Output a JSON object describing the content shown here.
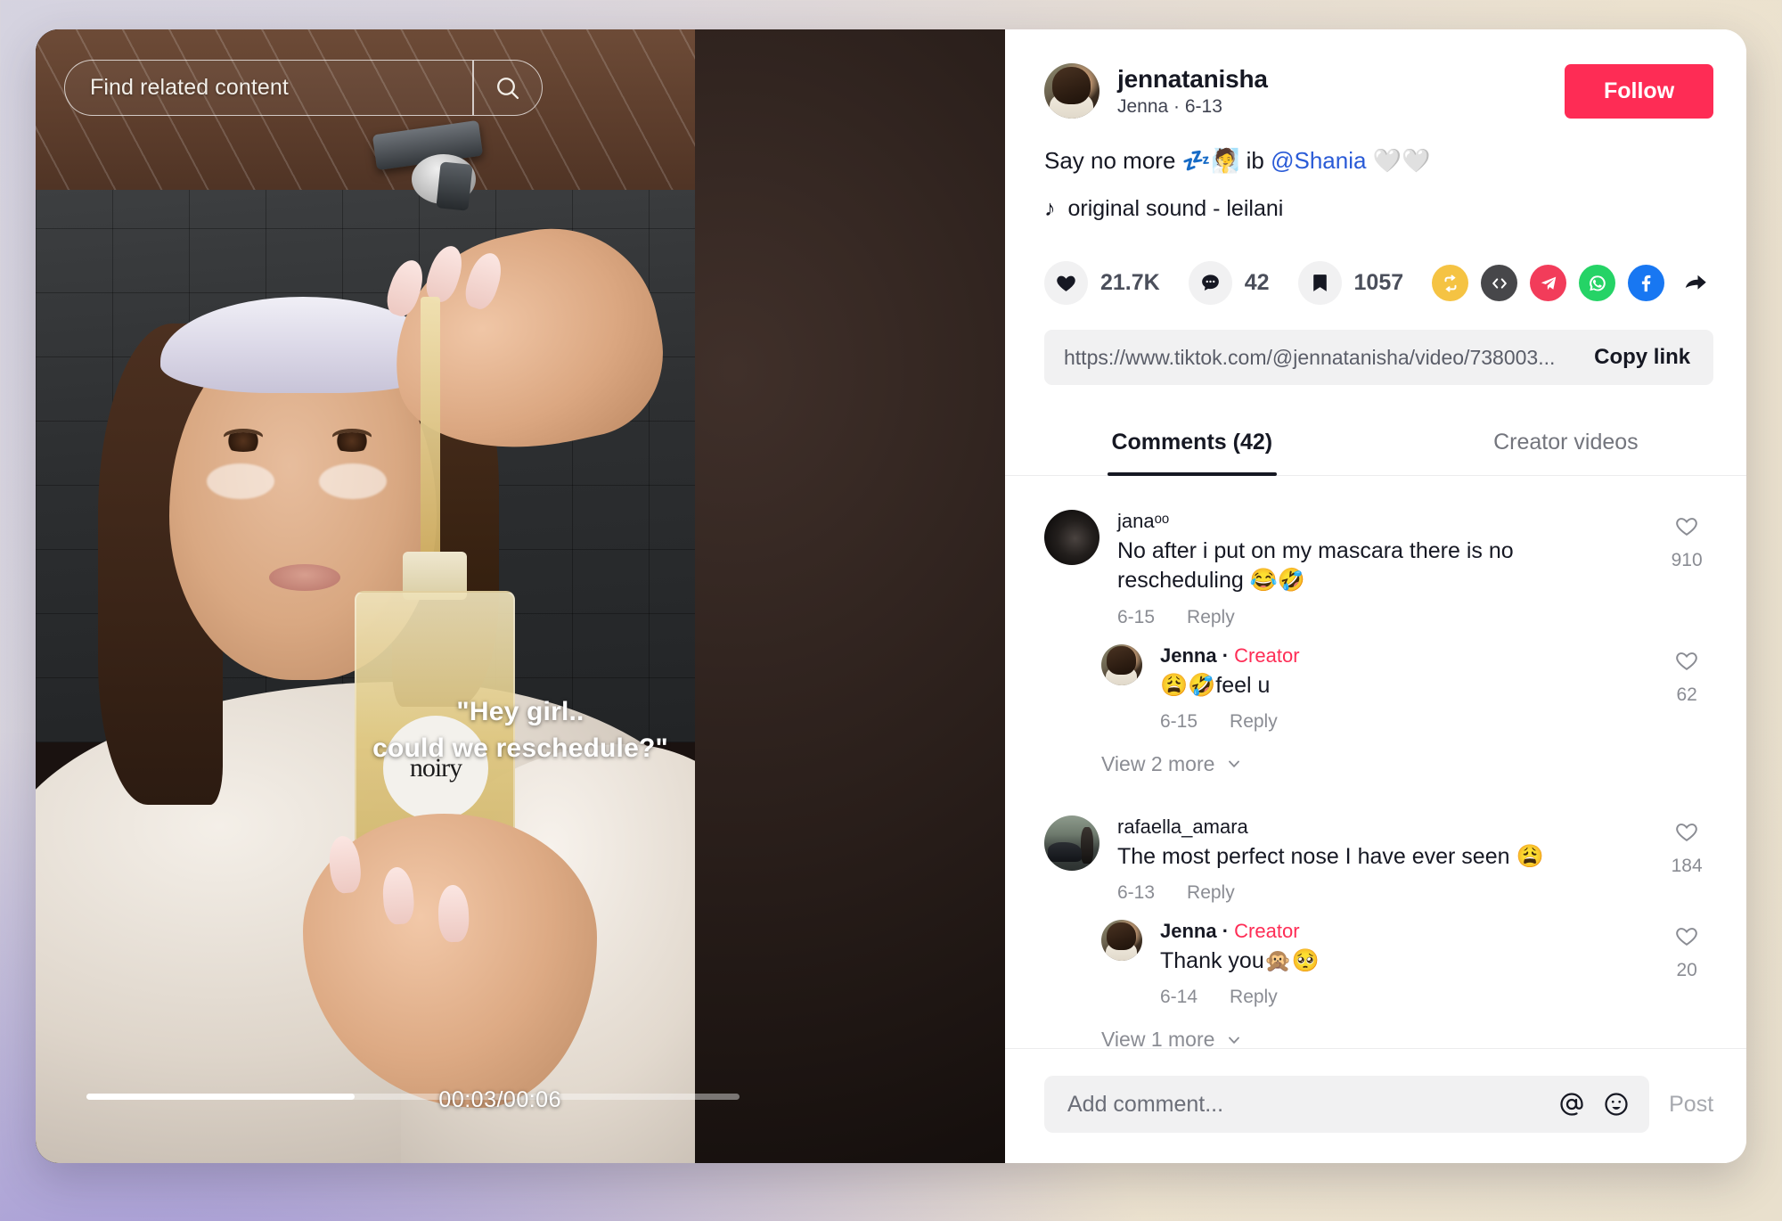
{
  "video": {
    "search_placeholder": "Find related content",
    "search_icon": "search-icon",
    "caption_line1": "\"Hey girl..",
    "caption_line2": "could we reschedule?\"",
    "bottle_label": "noiry",
    "time": "00:03/00:06",
    "progress_percent": 41
  },
  "author": {
    "username": "jennatanisha",
    "display_line": "Jenna · 6-13",
    "follow_label": "Follow"
  },
  "post": {
    "description_pre": "Say no more ",
    "description_emoji1": "💤🧖",
    "description_mid": " ib ",
    "mention": "@Shania",
    "description_emoji2": " 🤍🤍",
    "music_icon": "music-note-icon",
    "music": "original sound - leilani"
  },
  "stats": {
    "likes_icon": "heart-icon",
    "likes": "21.7K",
    "comments_icon": "comment-bubble-icon",
    "comments": "42",
    "saves_icon": "bookmark-icon",
    "saves": "1057"
  },
  "share": [
    {
      "name": "repost-icon",
      "color": "#f5c343"
    },
    {
      "name": "embed-code-icon",
      "color": "#47474a"
    },
    {
      "name": "telegram-icon",
      "color": "#f23c5a"
    },
    {
      "name": "whatsapp-icon",
      "color": "#25d366"
    },
    {
      "name": "facebook-icon",
      "color": "#1877f2"
    },
    {
      "name": "share-arrow-icon",
      "color": "#161823"
    }
  ],
  "link": {
    "url": "https://www.tiktok.com/@jennatanisha/video/738003...",
    "copy_label": "Copy link"
  },
  "tabs": {
    "comments_label": "Comments (42)",
    "creator_label": "Creator videos"
  },
  "comments": [
    {
      "avatar": "dark",
      "name": "janaᵒᵒ",
      "bold": false,
      "is_creator": false,
      "text": "No after i put on my mascara there is no rescheduling 😂🤣",
      "date": "6-15",
      "reply_label": "Reply",
      "like_icon": "heart-outline-icon",
      "likes": "910",
      "replies": [
        {
          "avatar": "creator",
          "name": "Jenna",
          "creator_tag": "Creator",
          "text": "😩🤣feel u",
          "date": "6-15",
          "reply_label": "Reply",
          "like_icon": "heart-outline-icon",
          "likes": "62"
        }
      ],
      "view_more": "View 2 more"
    },
    {
      "avatar": "car",
      "name": "rafaella_amara",
      "bold": false,
      "is_creator": false,
      "text": "The most perfect nose I have ever seen 😩",
      "date": "6-13",
      "reply_label": "Reply",
      "like_icon": "heart-outline-icon",
      "likes": "184",
      "replies": [
        {
          "avatar": "creator",
          "name": "Jenna",
          "creator_tag": "Creator",
          "text": "Thank you🙊🥺",
          "date": "6-14",
          "reply_label": "Reply",
          "like_icon": "heart-outline-icon",
          "likes": "20"
        }
      ],
      "view_more": "View 1 more"
    }
  ],
  "composer": {
    "placeholder": "Add comment...",
    "mention_icon": "at-mention-icon",
    "emoji_icon": "emoji-smiley-icon",
    "post_label": "Post"
  },
  "colors": {
    "brand_red": "#fe2c55",
    "text_dark": "#161823",
    "muted": "#8a8c93"
  }
}
